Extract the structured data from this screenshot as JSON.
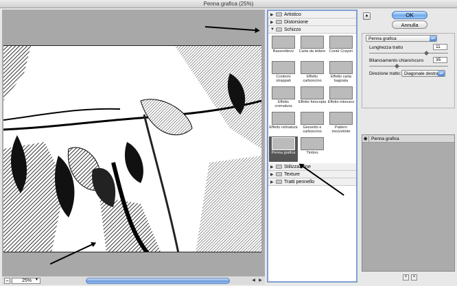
{
  "window": {
    "title": "Penna grafica (25%)"
  },
  "preview": {
    "zoom": "25%"
  },
  "gallery": {
    "categories_top": [
      {
        "label": "Artistico",
        "expanded": false
      },
      {
        "label": "Distorsione",
        "expanded": false
      },
      {
        "label": "Schizzo",
        "expanded": true
      }
    ],
    "schizzo_filters": [
      {
        "label": "Bassorilievo",
        "thumb": "t-bas"
      },
      {
        "label": "Carta da lettere",
        "thumb": "t-car"
      },
      {
        "label": "Conté Crayon",
        "thumb": "t-con"
      },
      {
        "label": "Contorni strappati",
        "thumb": "t-cs"
      },
      {
        "label": "Effetto carboncino",
        "thumb": "t-eca"
      },
      {
        "label": "Effetto carta bagnata",
        "thumb": "t-ecb"
      },
      {
        "label": "Effetto cromatura",
        "thumb": "t-ecr"
      },
      {
        "label": "Effetto fotocopia",
        "thumb": "t-ef"
      },
      {
        "label": "Effetto intonaco",
        "thumb": "t-ei"
      },
      {
        "label": "Effetto retinatura",
        "thumb": "t-er"
      },
      {
        "label": "Gessetto e carboncino",
        "thumb": "t-gc"
      },
      {
        "label": "Pattern mezzetinte",
        "thumb": "t-pm"
      },
      {
        "label": "Penna grafica",
        "thumb": "t-pg",
        "selected": true
      },
      {
        "label": "Timbro",
        "thumb": "t-ti"
      }
    ],
    "categories_bottom": [
      {
        "label": "Stilizzazione"
      },
      {
        "label": "Texture"
      },
      {
        "label": "Tratti pennello"
      }
    ]
  },
  "actions": {
    "ok": "OK",
    "cancel": "Annulla"
  },
  "settings": {
    "filter": "Penna grafica",
    "stroke_length": {
      "label": "Lunghezza tratto",
      "value": "11",
      "fraction": 0.73
    },
    "balance": {
      "label": "Bilanciamento chiaro/scuro",
      "value": "35",
      "fraction": 0.35
    },
    "direction": {
      "label": "Direzione tratto:",
      "value": "Diagonale destra"
    }
  },
  "layers": {
    "items": [
      {
        "label": "Penna grafica"
      }
    ]
  }
}
